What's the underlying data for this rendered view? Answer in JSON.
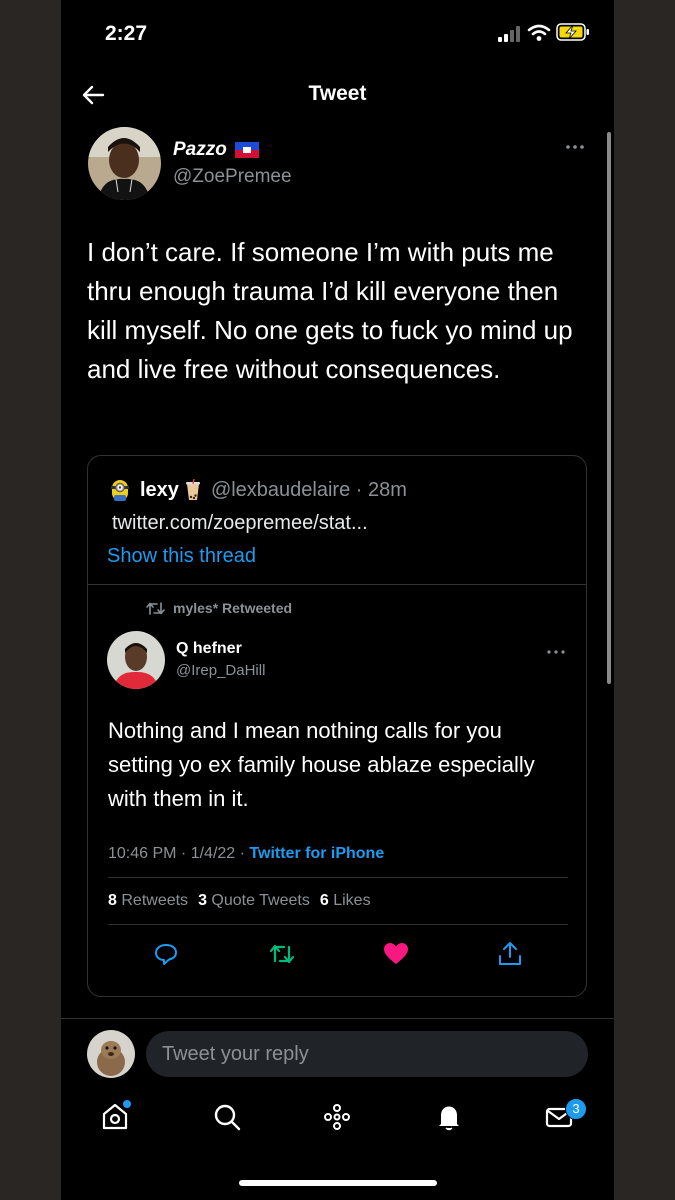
{
  "status_bar": {
    "time": "2:27"
  },
  "header": {
    "title": "Tweet"
  },
  "tweet": {
    "author_name": "Pazzo",
    "author_handle": "@ZoePremee",
    "text": "I don’t care. If someone I’m with puts me thru enough trauma I’d kill everyone then kill myself. No one gets to fuck yo mind up and live free without consequences."
  },
  "quoted": {
    "name": "lexy",
    "handle_time": "@lexbaudelaire · 28m",
    "link": "twitter.com/zoepremee/stat...",
    "show_thread": "Show this thread",
    "retweeted_by": "myles* Retweeted",
    "inner": {
      "name": "Q hefner",
      "handle": "@Irep_DaHill",
      "text": "Nothing and I mean nothing calls for you setting yo ex family house ablaze especially with them in it.",
      "timestamp": "10:46 PM · 1/4/22 · ",
      "source": "Twitter for iPhone",
      "retweets_count": "8",
      "retweets_label": "Retweets",
      "quotes_count": "3",
      "quotes_label": "Quote Tweets",
      "likes_count": "6",
      "likes_label": "Likes"
    }
  },
  "reply": {
    "placeholder": "Tweet your reply"
  },
  "tabbar": {
    "messages_badge": "3"
  },
  "colors": {
    "accent": "#1d9bf0",
    "like": "#f91880",
    "retweet": "#00ba7c",
    "background": "#000000"
  }
}
